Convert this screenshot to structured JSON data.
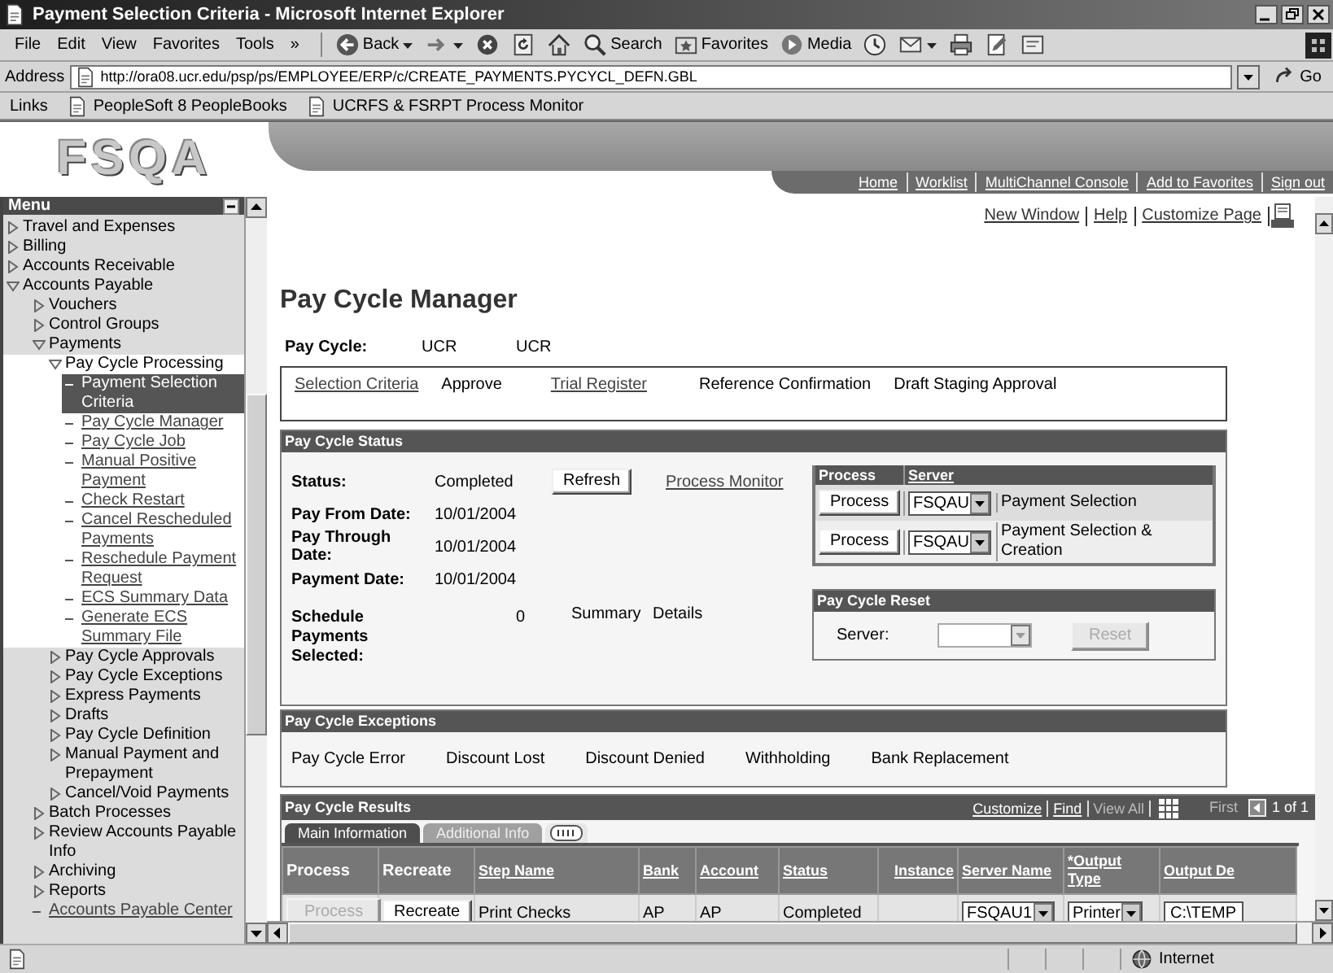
{
  "window": {
    "title": "Payment Selection Criteria - Microsoft Internet Explorer"
  },
  "menu_bar": [
    "File",
    "Edit",
    "View",
    "Favorites",
    "Tools",
    "»"
  ],
  "toolbar": [
    {
      "kind": "back",
      "label": "Back",
      "menu": true
    },
    {
      "kind": "forward",
      "menu": true
    },
    {
      "kind": "stop"
    },
    {
      "kind": "refresh"
    },
    {
      "kind": "home"
    },
    {
      "kind": "search",
      "label": "Search"
    },
    {
      "kind": "favorites",
      "label": "Favorites"
    },
    {
      "kind": "media",
      "label": "Media"
    },
    {
      "kind": "history"
    },
    {
      "kind": "mail",
      "menu": true
    },
    {
      "kind": "print"
    },
    {
      "kind": "edit"
    },
    {
      "kind": "discuss"
    }
  ],
  "address_bar": {
    "label": "Address",
    "url": "http://ora08.ucr.edu/psp/ps/EMPLOYEE/ERP/c/CREATE_PAYMENTS.PYCYCL_DEFN.GBL",
    "go": "Go"
  },
  "links_bar": {
    "label": "Links",
    "links": [
      "PeopleSoft 8 PeopleBooks",
      "UCRFS & FSRPT Process Monitor"
    ]
  },
  "header": {
    "logo": "FSQA",
    "nav": [
      "Home",
      "Worklist",
      "MultiChannel Console",
      "Add to Favorites",
      "Sign out"
    ]
  },
  "sidebar": {
    "title": "Menu",
    "items": [
      {
        "label": "Travel and Expenses",
        "kind": "folder",
        "expanded": false
      },
      {
        "label": "Billing",
        "kind": "folder",
        "expanded": false
      },
      {
        "label": "Accounts Receivable",
        "kind": "folder",
        "expanded": false
      },
      {
        "label": "Accounts Payable",
        "kind": "folder",
        "expanded": true,
        "children": [
          {
            "label": "Vouchers",
            "kind": "folder",
            "expanded": false
          },
          {
            "label": "Control Groups",
            "kind": "folder",
            "expanded": false
          },
          {
            "label": "Payments",
            "kind": "folder",
            "expanded": true,
            "children": [
              {
                "label": "Pay Cycle Processing",
                "kind": "folder",
                "expanded": true,
                "children": [
                  {
                    "label": "Payment Selection Criteria",
                    "kind": "page",
                    "selected": true
                  },
                  {
                    "label": "Pay Cycle Manager",
                    "kind": "page",
                    "selected": false
                  },
                  {
                    "label": "Pay Cycle Job",
                    "kind": "page",
                    "selected": false
                  },
                  {
                    "label": "Manual Positive Payment",
                    "kind": "page",
                    "selected": false
                  },
                  {
                    "label": "Check Restart",
                    "kind": "page",
                    "selected": false
                  },
                  {
                    "label": "Cancel Rescheduled Payments",
                    "kind": "page",
                    "selected": false
                  },
                  {
                    "label": "Reschedule Payment Request",
                    "kind": "page",
                    "selected": false
                  },
                  {
                    "label": "ECS Summary Data",
                    "kind": "page",
                    "selected": false
                  },
                  {
                    "label": "Generate ECS Summary File",
                    "kind": "page",
                    "selected": false
                  }
                ]
              },
              {
                "label": "Pay Cycle Approvals",
                "kind": "folder",
                "expanded": false
              },
              {
                "label": "Pay Cycle Exceptions",
                "kind": "folder",
                "expanded": false
              },
              {
                "label": "Express Payments",
                "kind": "folder",
                "expanded": false
              },
              {
                "label": "Drafts",
                "kind": "folder",
                "expanded": false
              },
              {
                "label": "Pay Cycle Definition",
                "kind": "folder",
                "expanded": false
              },
              {
                "label": "Manual Payment and Prepayment",
                "kind": "folder",
                "expanded": false
              },
              {
                "label": "Cancel/Void Payments",
                "kind": "folder",
                "expanded": false
              }
            ]
          },
          {
            "label": "Batch Processes",
            "kind": "folder",
            "expanded": false
          },
          {
            "label": "Review Accounts Payable Info",
            "kind": "folder",
            "expanded": false
          },
          {
            "label": "Archiving",
            "kind": "folder",
            "expanded": false
          },
          {
            "label": "Reports",
            "kind": "folder",
            "expanded": false
          },
          {
            "label": "Accounts Payable Center",
            "kind": "page",
            "selected": false
          }
        ]
      }
    ]
  },
  "page": {
    "links": [
      "New Window",
      "Help",
      "Customize Page"
    ],
    "title": "Pay Cycle Manager",
    "pay_cycle": {
      "label": "Pay Cycle:",
      "values": [
        "UCR",
        "UCR"
      ]
    },
    "steps": [
      {
        "label": "Selection Criteria",
        "kind": "link"
      },
      {
        "label": "Approve",
        "kind": "text"
      },
      {
        "label": "Trial Register",
        "kind": "link"
      },
      {
        "label": "Reference Confirmation",
        "kind": "text"
      },
      {
        "label": "Draft Staging Approval",
        "kind": "text"
      }
    ],
    "status": {
      "title": "Pay Cycle Status",
      "fields": [
        {
          "label": "Status:",
          "value": "Completed"
        },
        {
          "label": "Pay From Date:",
          "value": "10/01/2004"
        },
        {
          "label": "Pay Through Date:",
          "value": "10/01/2004"
        },
        {
          "label": "Payment Date:",
          "value": "10/01/2004"
        }
      ],
      "refresh_button": "Refresh",
      "process_monitor": "Process Monitor",
      "scheduled": {
        "label": "Schedule Payments Selected:",
        "value": "0"
      },
      "views": [
        "Summary",
        "Details"
      ],
      "processes": {
        "columns": [
          {
            "label": "Process",
            "sortable": false
          },
          {
            "label": "Server",
            "sortable": true
          }
        ],
        "rows": [
          {
            "button": "Process",
            "server": "FSQAU",
            "description": "Payment Selection"
          },
          {
            "button": "Process",
            "server": "FSQAU",
            "description": "Payment Selection & Creation"
          }
        ]
      },
      "reset": {
        "title": "Pay Cycle Reset",
        "label": "Server:",
        "button": "Reset",
        "disabled": true
      }
    },
    "exceptions": {
      "title": "Pay Cycle Exceptions",
      "items": [
        "Pay Cycle Error",
        "Discount Lost",
        "Discount Denied",
        "Withholding",
        "Bank Replacement"
      ]
    },
    "results": {
      "title": "Pay Cycle Results",
      "links": [
        {
          "label": "Customize",
          "disabled": false
        },
        {
          "label": "Find",
          "disabled": false
        },
        {
          "label": "View All",
          "disabled": true
        }
      ],
      "pager": {
        "first": "First",
        "range": "1 of 1"
      },
      "tabs": [
        {
          "label": "Main Information",
          "selected": true
        },
        {
          "label": "Additional Info",
          "selected": false
        }
      ],
      "columns": [
        {
          "label": "Process",
          "sortable": false
        },
        {
          "label": "Recreate",
          "sortable": false
        },
        {
          "label": "Step Name",
          "sortable": true
        },
        {
          "label": "Bank",
          "sortable": true
        },
        {
          "label": "Account",
          "sortable": true
        },
        {
          "label": "Status",
          "sortable": true
        },
        {
          "label": "Instance",
          "sortable": true
        },
        {
          "label": "Server Name",
          "sortable": true
        },
        {
          "label": "*Output Type",
          "sortable": true
        },
        {
          "label": "Output De",
          "sortable": true
        }
      ],
      "rows": [
        {
          "cells": [
            {
              "kind": "button",
              "text": "Process",
              "disabled": true
            },
            {
              "kind": "button",
              "text": "Recreate",
              "disabled": false
            },
            {
              "kind": "text",
              "text": "Print Checks"
            },
            {
              "kind": "text",
              "text": "AP"
            },
            {
              "kind": "text",
              "text": "AP"
            },
            {
              "kind": "text",
              "text": "Completed"
            },
            {
              "kind": "blank"
            },
            {
              "kind": "select",
              "text": "FSQAU1"
            },
            {
              "kind": "select",
              "text": "Printer"
            },
            {
              "kind": "input",
              "text": "C:\\TEMP"
            }
          ]
        }
      ]
    }
  },
  "status_bar": {
    "zone": "Internet"
  }
}
